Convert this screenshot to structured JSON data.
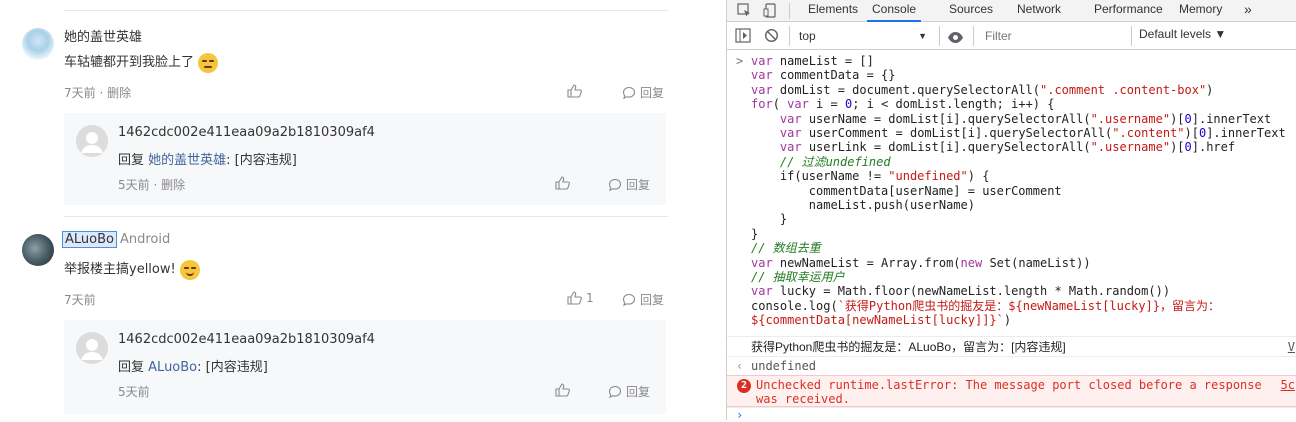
{
  "comments": {
    "c1": {
      "user": "她的盖世英雄",
      "text": "车轱辘都开到我脸上了",
      "time": "7天前",
      "delete": "删除",
      "reply_label": "回复",
      "reply": {
        "user": "1462cdc002e411eaa09a2b1810309af4",
        "prefix": "回复",
        "target": "她的盖世英雄",
        "suffix": ": [内容违规]",
        "time": "5天前",
        "delete": "删除",
        "reply_label": "回复"
      }
    },
    "c2": {
      "user": "ALuoBo",
      "device": "Android",
      "text": "举报楼主搞yellow!",
      "time": "7天前",
      "likes": "1",
      "reply_label": "回复",
      "reply": {
        "user": "1462cdc002e411eaa09a2b1810309af4",
        "prefix": "回复",
        "target": "ALuoBo",
        "suffix": ": [内容违规]",
        "time": "5天前",
        "reply_label": "回复"
      }
    },
    "dot": "·"
  },
  "devtools": {
    "tabs": [
      "Elements",
      "Console",
      "Sources",
      "Network",
      "Performance",
      "Memory"
    ],
    "more": "»",
    "context": "top",
    "filter_placeholder": "Filter",
    "levels": "Default levels ▼",
    "prompt": ">",
    "code": [
      "var nameList = []",
      "var commentData = {}",
      "var domList = document.querySelectorAll(\".comment .content-box\")",
      "for( var i = 0; i < domList.length; i++) {",
      "    var userName = domList[i].querySelectorAll(\".username\")[0].innerText",
      "    var userComment = domList[i].querySelectorAll(\".content\")[0].innerText",
      "    var userLink = domList[i].querySelectorAll(\".username\")[0].href",
      "    // 过滤undefined",
      "    if(userName != \"undefined\") {",
      "        commentData[userName] = userComment",
      "        nameList.push(userName)",
      "    }",
      "}",
      "// 数组去重",
      "var newNameList = Array.from(new Set(nameList))",
      "// 抽取幸运用户",
      "var lucky = Math.floor(newNameList.length * Math.random())",
      "console.log(`获得Python爬虫书的掘友是：${newNameList[lucky]}，留言为：",
      "${commentData[newNameList[lucky]]}`)"
    ],
    "log_output": "获得Python爬虫书的掘友是：ALuoBo，留言为：[内容违规]",
    "log_source": "V",
    "result_arrow": "‹",
    "result": "undefined",
    "error_count": "2",
    "error_line1": "Unchecked runtime.lastError: The message port closed before a response",
    "error_line2": "was received.",
    "error_source": "5c",
    "input_prompt": "›"
  }
}
